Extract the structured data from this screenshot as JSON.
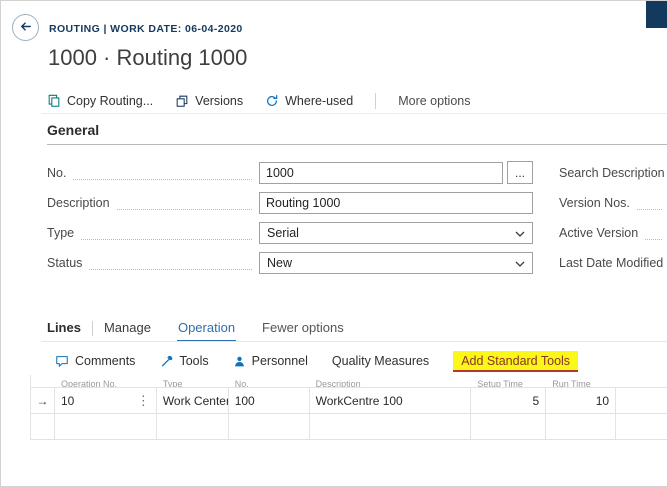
{
  "colors": {
    "navy": "#14395e",
    "link-blue": "#2f6fad",
    "icon-blue": "#1071bc",
    "teal": "#03787c",
    "highlight-bg": "#fbf719",
    "highlight-text": "#8b3226",
    "highlight-underline": "#b3392f"
  },
  "chrome": {
    "breadcrumb": "ROUTING | WORK DATE: 06-04-2020"
  },
  "page": {
    "title": "1000 · Routing 1000"
  },
  "actionbar": {
    "items": [
      {
        "label": "Copy Routing...",
        "icon": "copy-icon"
      },
      {
        "label": "Versions",
        "icon": "versions-icon"
      },
      {
        "label": "Where-used",
        "icon": "where-used-icon"
      }
    ],
    "more": "More options"
  },
  "general": {
    "heading": "General",
    "assist_button": "...",
    "fields": [
      {
        "label": "No.",
        "value": "1000"
      },
      {
        "label": "Description",
        "value": "Routing 1000"
      },
      {
        "label": "Type",
        "value": "Serial"
      },
      {
        "label": "Status",
        "value": "New"
      }
    ],
    "right_fields": [
      {
        "label": "Search Description"
      },
      {
        "label": "Version Nos."
      },
      {
        "label": "Active Version"
      },
      {
        "label": "Last Date Modified"
      }
    ]
  },
  "lines": {
    "tabs": {
      "lines": "Lines",
      "manage": "Manage",
      "operation": "Operation",
      "fewer": "Fewer options"
    },
    "toolbar": [
      {
        "label": "Comments",
        "icon": "comment-icon"
      },
      {
        "label": "Tools",
        "icon": "tools-icon"
      },
      {
        "label": "Personnel",
        "icon": "personnel-icon"
      },
      {
        "label": "Quality Measures",
        "icon": ""
      },
      {
        "label": "Add Standard Tools",
        "icon": "",
        "highlight": true
      }
    ],
    "table": {
      "row_marker": "→",
      "menu_icon": "⋮",
      "headers": [
        "Operation No.",
        "Type",
        "No.",
        "Description",
        "Setup Time",
        "Run Time"
      ],
      "rows": [
        {
          "operation_no": "10",
          "type": "Work Center",
          "no": "100",
          "description": "WorkCentre 100",
          "setup_time": "5",
          "run_time": "10"
        }
      ]
    }
  }
}
